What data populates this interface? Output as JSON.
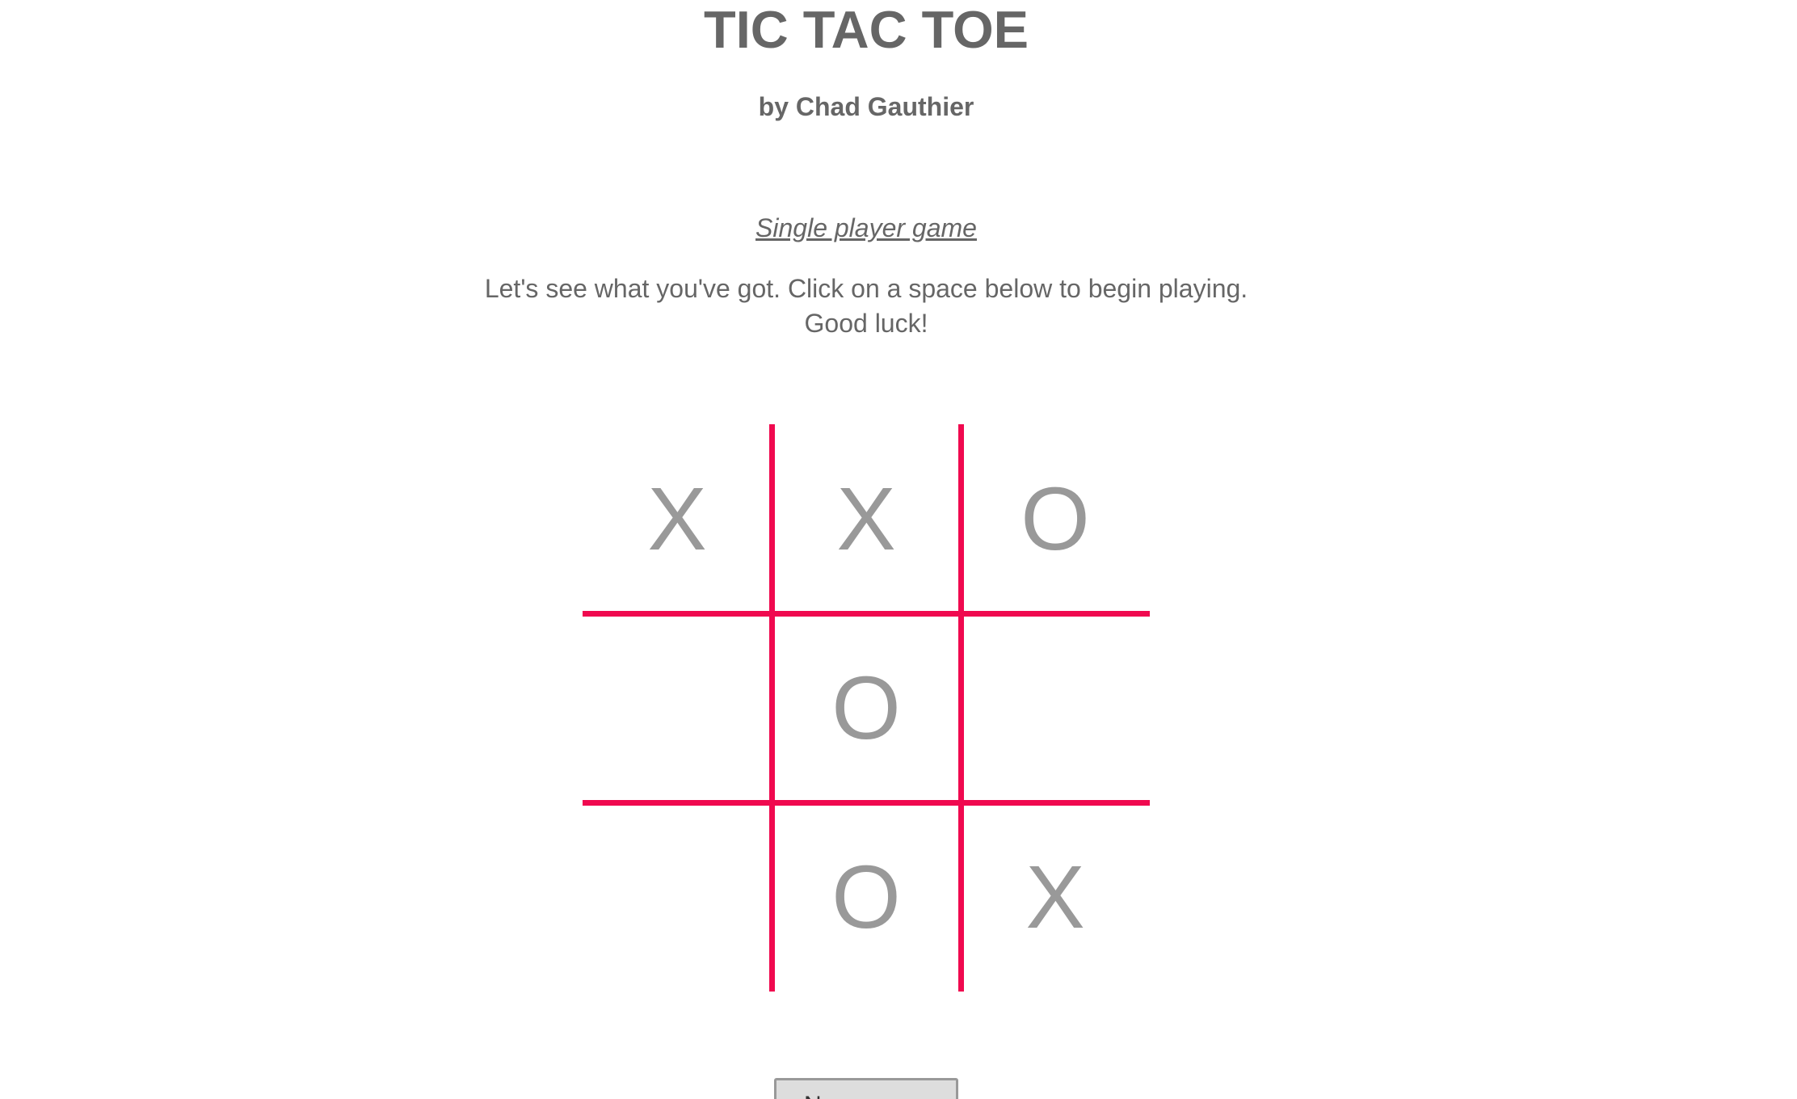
{
  "header": {
    "title": "TIC TAC TOE",
    "byline": "by Chad Gauthier"
  },
  "mode": {
    "label": "Single player game"
  },
  "instructions": {
    "line1": "Let's see what you've got. Click on a space below to begin playing.",
    "line2": "Good luck!"
  },
  "board": {
    "cells": [
      "X",
      "X",
      "O",
      "",
      "O",
      "",
      "",
      "O",
      "X"
    ],
    "line_color": "#f0094f",
    "mark_color": "#999999"
  },
  "controls": {
    "new_game_label": "N"
  }
}
